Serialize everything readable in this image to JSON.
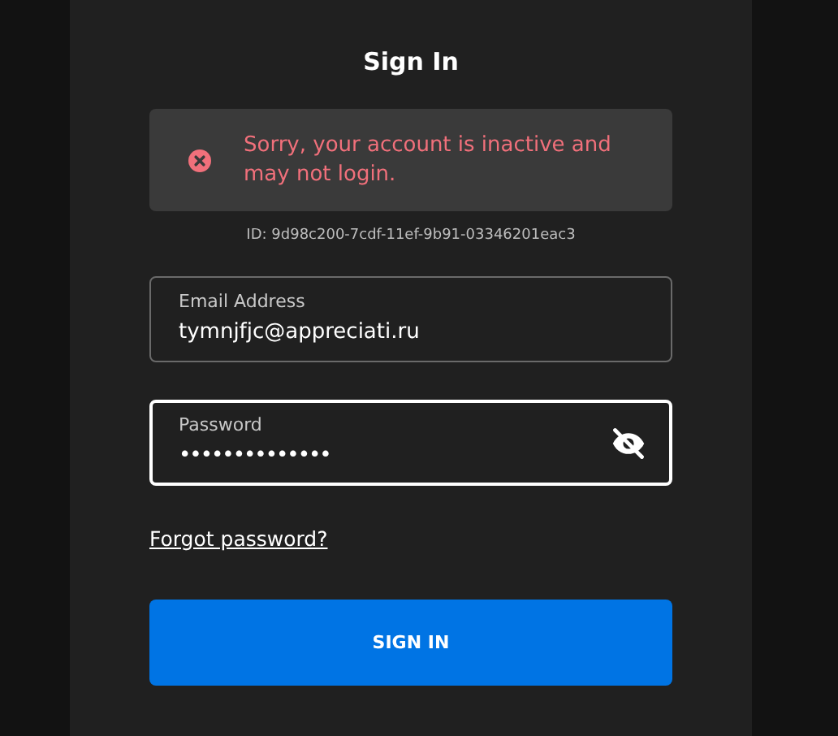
{
  "title": "Sign In",
  "alert": {
    "kind": "error",
    "message": "Sorry, your account is inactive and may not login."
  },
  "error_id": "ID: 9d98c200-7cdf-11ef-9b91-03346201eac3",
  "fields": [
    {
      "kind": "text",
      "label": "Email Address",
      "value": "tymnjfjc@appreciati.ru",
      "focused": false
    },
    {
      "kind": "password",
      "label": "Password",
      "value": "••••••••••••••",
      "focused": true,
      "revealed": false
    }
  ],
  "forgot_link": "Forgot password?",
  "submit_button": "SIGN IN"
}
